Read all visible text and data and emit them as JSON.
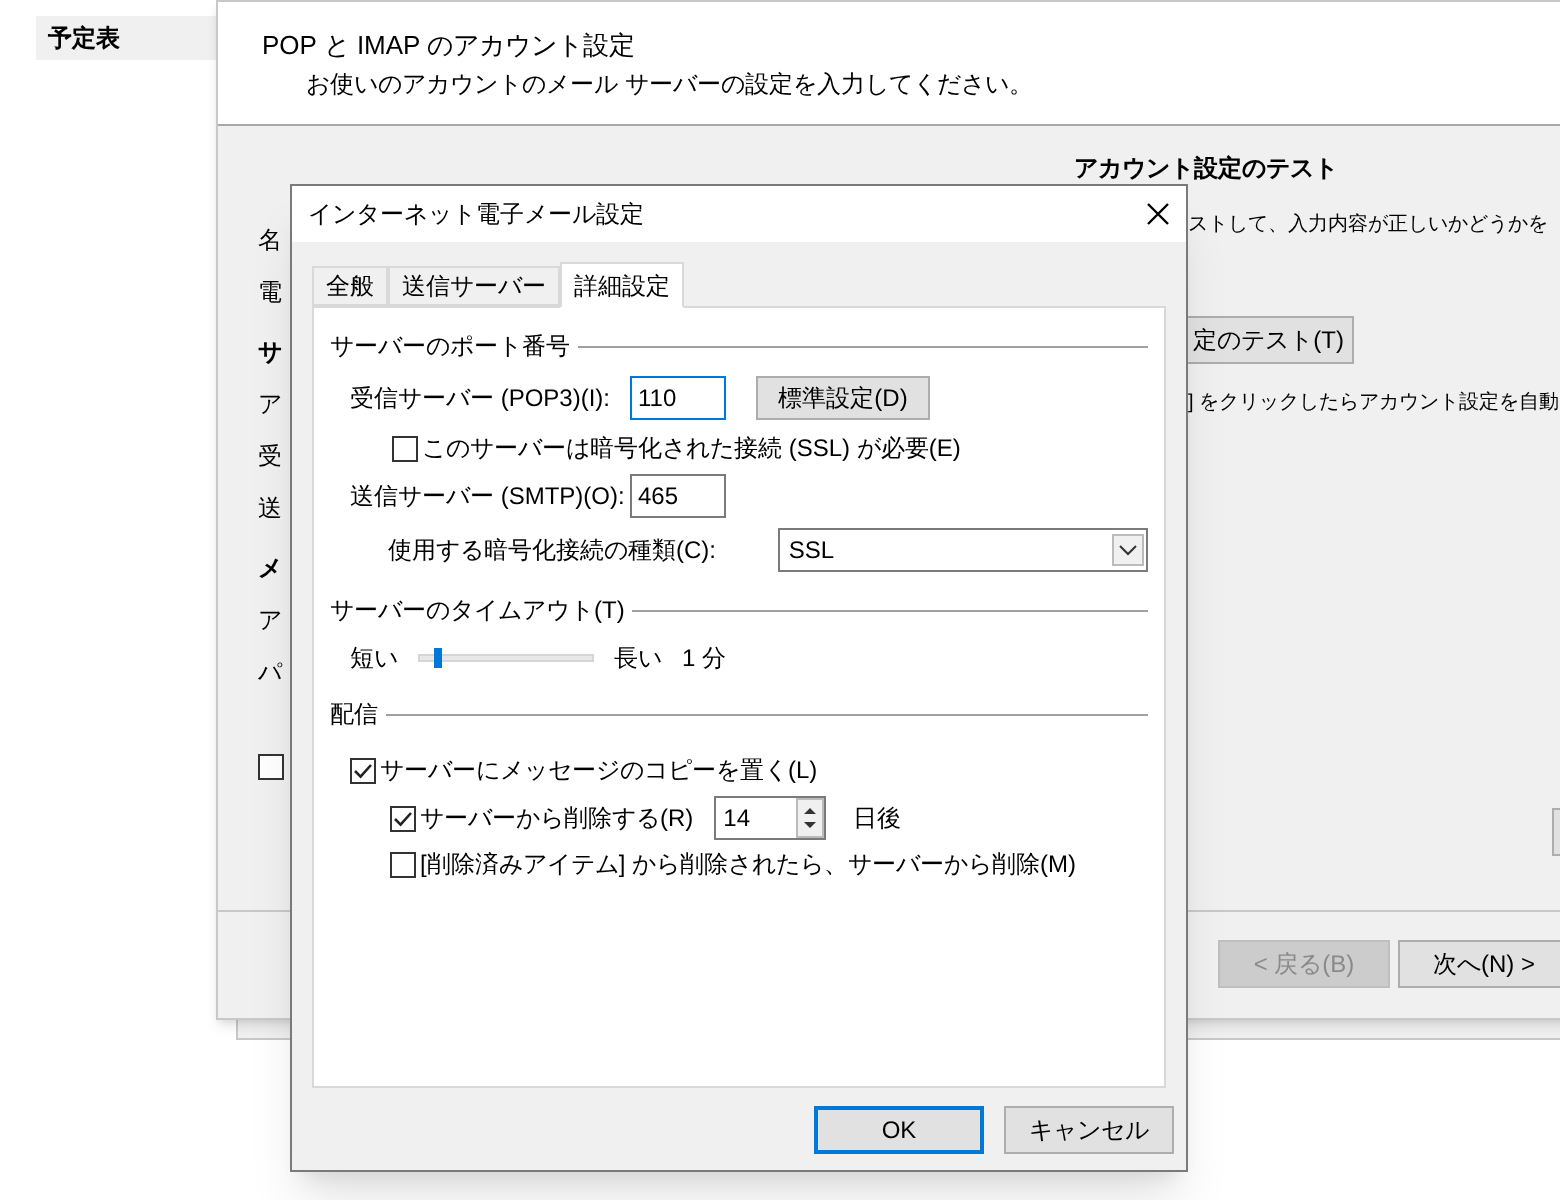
{
  "sidebar": {
    "items": [
      {
        "label": "予定表",
        "selected": true
      }
    ]
  },
  "main_window": {
    "title": "POP と IMAP のアカウント設定",
    "subtitle": "お使いのアカウントのメール サーバーの設定を入力してください。",
    "left_fragments": [
      {
        "text": "名",
        "kind": "label"
      },
      {
        "text": "電",
        "kind": "label"
      },
      {
        "text": "サ",
        "kind": "heading"
      },
      {
        "text": "ア",
        "kind": "label"
      },
      {
        "text": "受",
        "kind": "label"
      },
      {
        "text": "送",
        "kind": "label"
      },
      {
        "text": "メ",
        "kind": "heading"
      },
      {
        "text": "ア",
        "kind": "label"
      },
      {
        "text": "パ",
        "kind": "label"
      }
    ],
    "left_checkbox": {
      "checked": false
    },
    "test_heading": "アカウント設定のテスト",
    "test_text": "ストして、入力内容が正しいかどうかを",
    "test_button": "定のテスト(T)",
    "auto_text": "] をクリックしたらアカウント設定を自動",
    "buttons": [
      {
        "label": "< 戻る(B)",
        "disabled": true
      },
      {
        "label": "次へ(N) >",
        "disabled": false
      }
    ]
  },
  "dialog": {
    "title": "インターネット電子メール設定",
    "tabs": [
      {
        "label": "全般",
        "selected": false
      },
      {
        "label": "送信サーバー",
        "selected": false
      },
      {
        "label": "詳細設定",
        "selected": true
      }
    ],
    "port_section": "サーバーのポート番号",
    "incoming_label": "受信サーバー (POP3)(I):",
    "incoming_value": "110",
    "default_button": "標準設定(D)",
    "ssl_required": {
      "label": "このサーバーは暗号化された接続 (SSL) が必要(E)",
      "checked": false
    },
    "outgoing_label": "送信サーバー (SMTP)(O):",
    "outgoing_value": "465",
    "encryption_label": "使用する暗号化接続の種類(C):",
    "encryption_value": "SSL",
    "timeout_section": "サーバーのタイムアウト(T)",
    "timeout_short": "短い",
    "timeout_long": "長い",
    "timeout": {
      "level": 0.1
    },
    "timeout_reading": "1 分",
    "delivery_section": "配信",
    "leave_copy": {
      "label": "サーバーにメッセージのコピーを置く(L)",
      "checked": true
    },
    "remove_after": {
      "label": "サーバーから削除する(R)",
      "checked": true
    },
    "remove_days": "14",
    "days_suffix": "日後",
    "remove_deleted": {
      "label": "[削除済みアイテム] から削除されたら、サーバーから削除(M)",
      "checked": false
    },
    "buttons": [
      {
        "label": "OK",
        "kind": "default"
      },
      {
        "label": "キャンセル",
        "kind": "normal"
      }
    ]
  }
}
